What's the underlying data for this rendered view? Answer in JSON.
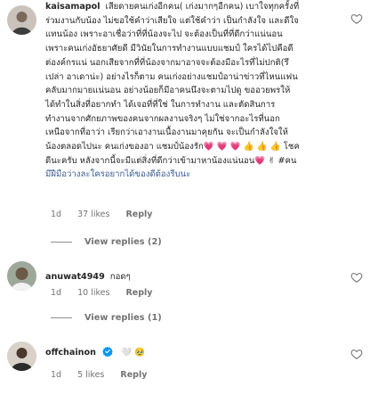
{
  "comments": [
    {
      "username": "kaisamapol",
      "lines": [
        "เสียดายคนเก่งอีกคน( เก่งมากๆอีกคน) เบาใจทุกครั้งที่",
        "ร่วมงานกับน้อง ไม่ขอใช้คำว่าเสียใจ แต่ใช้คำว่า เป็นกำลังใจ และดีใจ",
        "แทนน้อง เพราะอาเชื่อว่าที่ที่น้องจะไป จะต้องเป็นที่ที่ดีกว่าแน่นอน",
        "เพราะคนเก่งอัธยาศัยดี มีวินัยในการทำงานแบบแชมป์ ใครได้ไปคือดี",
        "ต่องค์กรแน่ นอกเสียจากที่ที่น้องจากมาอาจจะต้องมีอะไรที่ไม่ปกติ(รึ",
        "เปล่า อาเดาน่ะ) อย่างไรก็ตาม คนเก่งอย่างแชมป์อาน่าข่าวที่ไหนแฟน",
        "คลับมากมายแน่นอน อย่างน้อยก็มีอาคนนึงจะตามไปดู ขออวยพรให้",
        "ได้ทำในสิ่งที่อยากทำ ได้เจอที่ที่ใช่ ในการทำงาน และตัดสินการ",
        "ทำงานจากศักยภาพของคนจากผลงานจริงๆ ไม่ใช่จากอะไรที่นอก",
        "เหนือจากที่อาว่า เรียกว่าเอางานเนื้องานมาคุยกัน จะเป็นกำลังใจให้",
        "น้องตลอดไปนะ คนเก่งของอา แชมป์น้องรัก💗 💗 💗 👍 👍 👍 โชค",
        "ดีนะครับ หลังจากนี้จะมีแต่สิ่งที่ดีกว่าเข้ามาหาน้องแน่นอน💗 ✌ #คน",
        "มีฝีมือว่างละใครอยากได้ของดีต้องรีบนะ"
      ],
      "time": "1d",
      "likes": "37 likes",
      "reply": "Reply",
      "view_replies": "View replies (2)"
    },
    {
      "username": "anuwat4949",
      "text": "กอดๆ",
      "time": "1d",
      "likes": "10 likes",
      "reply": "Reply",
      "view_replies": "View replies (1)"
    },
    {
      "username": "offchainon",
      "text": "🤍 🥹",
      "time": "1d",
      "likes": "5 likes",
      "reply": "Reply"
    }
  ],
  "colors": {
    "text": "#262626",
    "meta": "#737373",
    "hashtag": "#3b5b93",
    "verified": "#0095f6"
  },
  "icons": {
    "like": "heart-outline-icon",
    "verified": "verified-badge-icon"
  }
}
